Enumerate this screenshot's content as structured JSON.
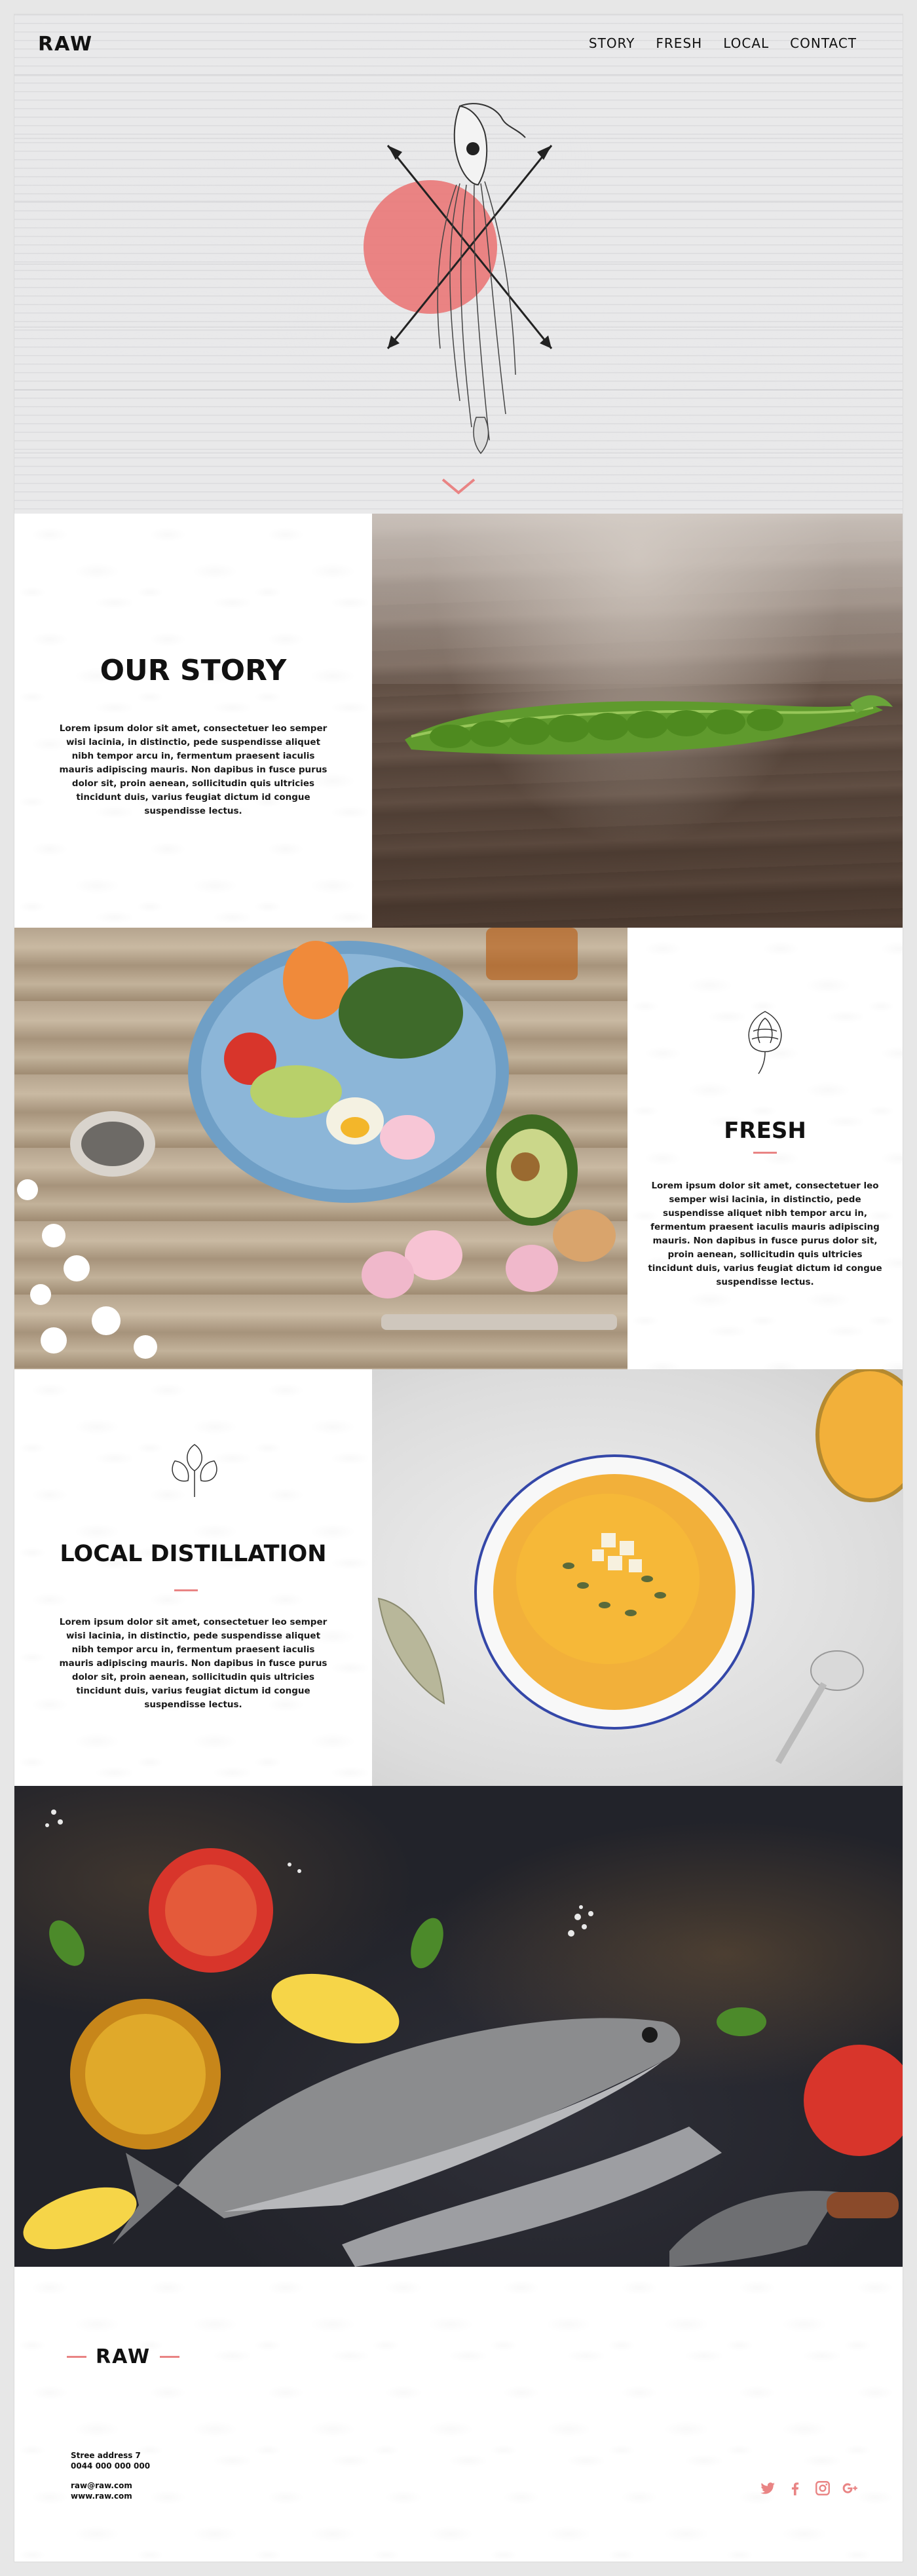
{
  "header": {
    "logo": "RAW",
    "nav": [
      {
        "label": "STORY"
      },
      {
        "label": "FRESH"
      },
      {
        "label": "LOCAL"
      },
      {
        "label": "CONTACT"
      }
    ]
  },
  "hero": {
    "illustration_icon": "bird-skull-with-crossed-arrows-icon",
    "accent_circle_color": "#e97a7a",
    "scroll_icon": "chevron-down-icon"
  },
  "story": {
    "title": "OUR STORY",
    "body": "Lorem ipsum dolor sit amet, consectetuer leo semper wisi lacinia, in distinctio, pede suspendisse aliquet nibh tempor arcu in, fermentum praesent iaculis mauris adipiscing mauris. Non dapibus in fusce purus dolor sit, proin aenean, sollicitudin quis ultricies tincidunt duis, varius feugiat dictum id congue suspendisse lectus.",
    "photo": "pea-pod-on-wood"
  },
  "fresh": {
    "title": "FRESH",
    "icon": "artichoke-icon",
    "body": "Lorem ipsum dolor sit amet, consectetuer leo semper wisi lacinia, in distinctio, pede suspendisse aliquet nibh tempor arcu in, fermentum praesent iaculis mauris adipiscing mauris. Non dapibus in fusce purus dolor sit, proin aenean, sollicitudin quis ultricies tincidunt duis, varius feugiat dictum id congue suspendisse lectus.",
    "photo": "salad-bowl-on-wood"
  },
  "local": {
    "title": "LOCAL DISTILLATION",
    "icon": "herb-sprig-icon",
    "body": "Lorem ipsum dolor sit amet, consectetuer leo semper wisi lacinia, in distinctio, pede suspendisse aliquet nibh tempor arcu in, fermentum praesent iaculis mauris adipiscing mauris. Non dapibus in fusce purus dolor sit, proin aenean, sollicitudin quis ultricies tincidunt duis, varius feugiat dictum id congue suspendisse lectus.",
    "photo": "pumpkin-soup-bowl"
  },
  "fish": {
    "photo": "raw-trout-with-tomatoes-and-lemon"
  },
  "footer": {
    "logo": "RAW",
    "address_line1": "Stree address 7",
    "address_line2": "0044 000 000 000",
    "email": "raw@raw.com",
    "website": "www.raw.com",
    "social": [
      {
        "icon": "twitter-icon"
      },
      {
        "icon": "facebook-icon"
      },
      {
        "icon": "instagram-icon"
      },
      {
        "icon": "google-plus-icon"
      }
    ],
    "social_color": "#e98484"
  },
  "colors": {
    "accent": "#e98484",
    "text": "#111111"
  }
}
